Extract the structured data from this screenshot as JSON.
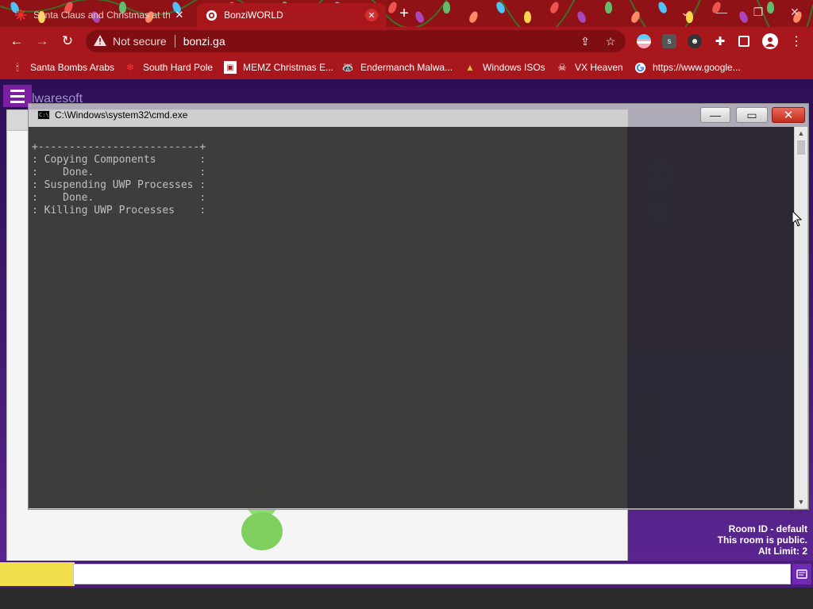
{
  "browser": {
    "tabs": [
      {
        "title": "Santa Claus and Christmas at th",
        "active": false,
        "favicon": "snowflake-icon"
      },
      {
        "title": "BonziWORLD",
        "active": true,
        "favicon": "globe-icon"
      }
    ],
    "new_tab": "+",
    "window_controls": {
      "dropdown": "⌄",
      "minimize": "—",
      "restore": "❐",
      "close": "✕"
    },
    "nav": {
      "back": "←",
      "forward": "→",
      "reload": "↻"
    },
    "address": {
      "security_label": "Not secure",
      "url": "bonzi.ga"
    },
    "bookmarks": [
      {
        "label": "Santa Bombs Arabs",
        "icon": "candle-icon"
      },
      {
        "label": "South Hard Pole",
        "icon": "snowflake-icon"
      },
      {
        "label": "MEMZ Christmas E...",
        "icon": "window-icon"
      },
      {
        "label": "Endermanch Malwa...",
        "icon": "raccoon-icon"
      },
      {
        "label": "Windows ISOs",
        "icon": "tree-icon"
      },
      {
        "label": "VX Heaven",
        "icon": "skull-icon"
      },
      {
        "label": "https://www.google...",
        "icon": "google-icon"
      }
    ]
  },
  "page": {
    "brand": "lwaresoft",
    "room": {
      "id": "Room ID - default",
      "visibility": "This room is public.",
      "alt_limit": "Alt Limit: 2"
    },
    "colors": {
      "accent": "#7b1fa2",
      "background": "#4a1e7a"
    }
  },
  "cmd": {
    "title": "C:\\Windows\\system32\\cmd.exe",
    "console_lines": [
      "+--------------------------+",
      ": Copying Components       :",
      ":    Done.                 :",
      ": Suspending UWP Processes :",
      ":    Done.                 :",
      ": Killing UWP Processes    :"
    ],
    "buttons": {
      "minimize": "—",
      "maximize": "▭",
      "close": "✕"
    }
  }
}
